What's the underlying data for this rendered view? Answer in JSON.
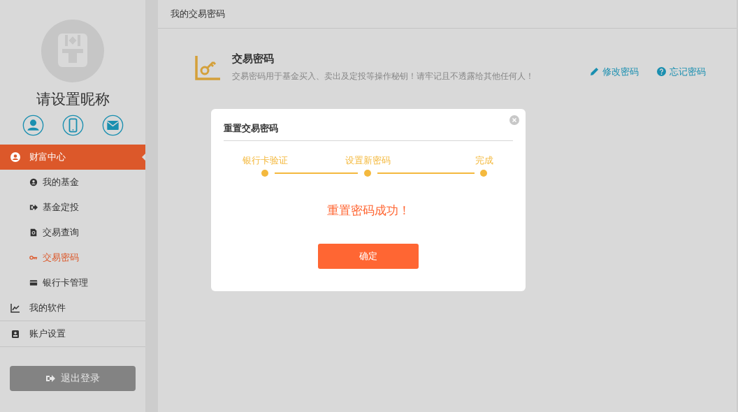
{
  "sidebar": {
    "nickname": "请设置昵称",
    "menu": [
      {
        "label": "财富中心",
        "selected": true,
        "children": [
          {
            "label": "我的基金",
            "selected": false
          },
          {
            "label": "基金定投",
            "selected": false
          },
          {
            "label": "交易查询",
            "selected": false
          },
          {
            "label": "交易密码",
            "selected": true
          },
          {
            "label": "银行卡管理",
            "selected": false
          }
        ]
      },
      {
        "label": "我的软件",
        "selected": false
      },
      {
        "label": "账户设置",
        "selected": false
      }
    ],
    "logout": "退出登录"
  },
  "header": {
    "title": "我的交易密码"
  },
  "section": {
    "title": "交易密码",
    "description": "交易密码用于基金买入、卖出及定投等操作秘钥！请牢记且不透露给其他任何人！",
    "actions": [
      "修改密码",
      "忘记密码"
    ]
  },
  "dialog": {
    "title": "重置交易密码",
    "steps": [
      {
        "label": "银行卡验证",
        "done": true
      },
      {
        "label": "设置新密码",
        "done": true
      },
      {
        "label": "完成",
        "done": true
      }
    ],
    "message": "重置密码成功！",
    "confirm": "确定"
  }
}
